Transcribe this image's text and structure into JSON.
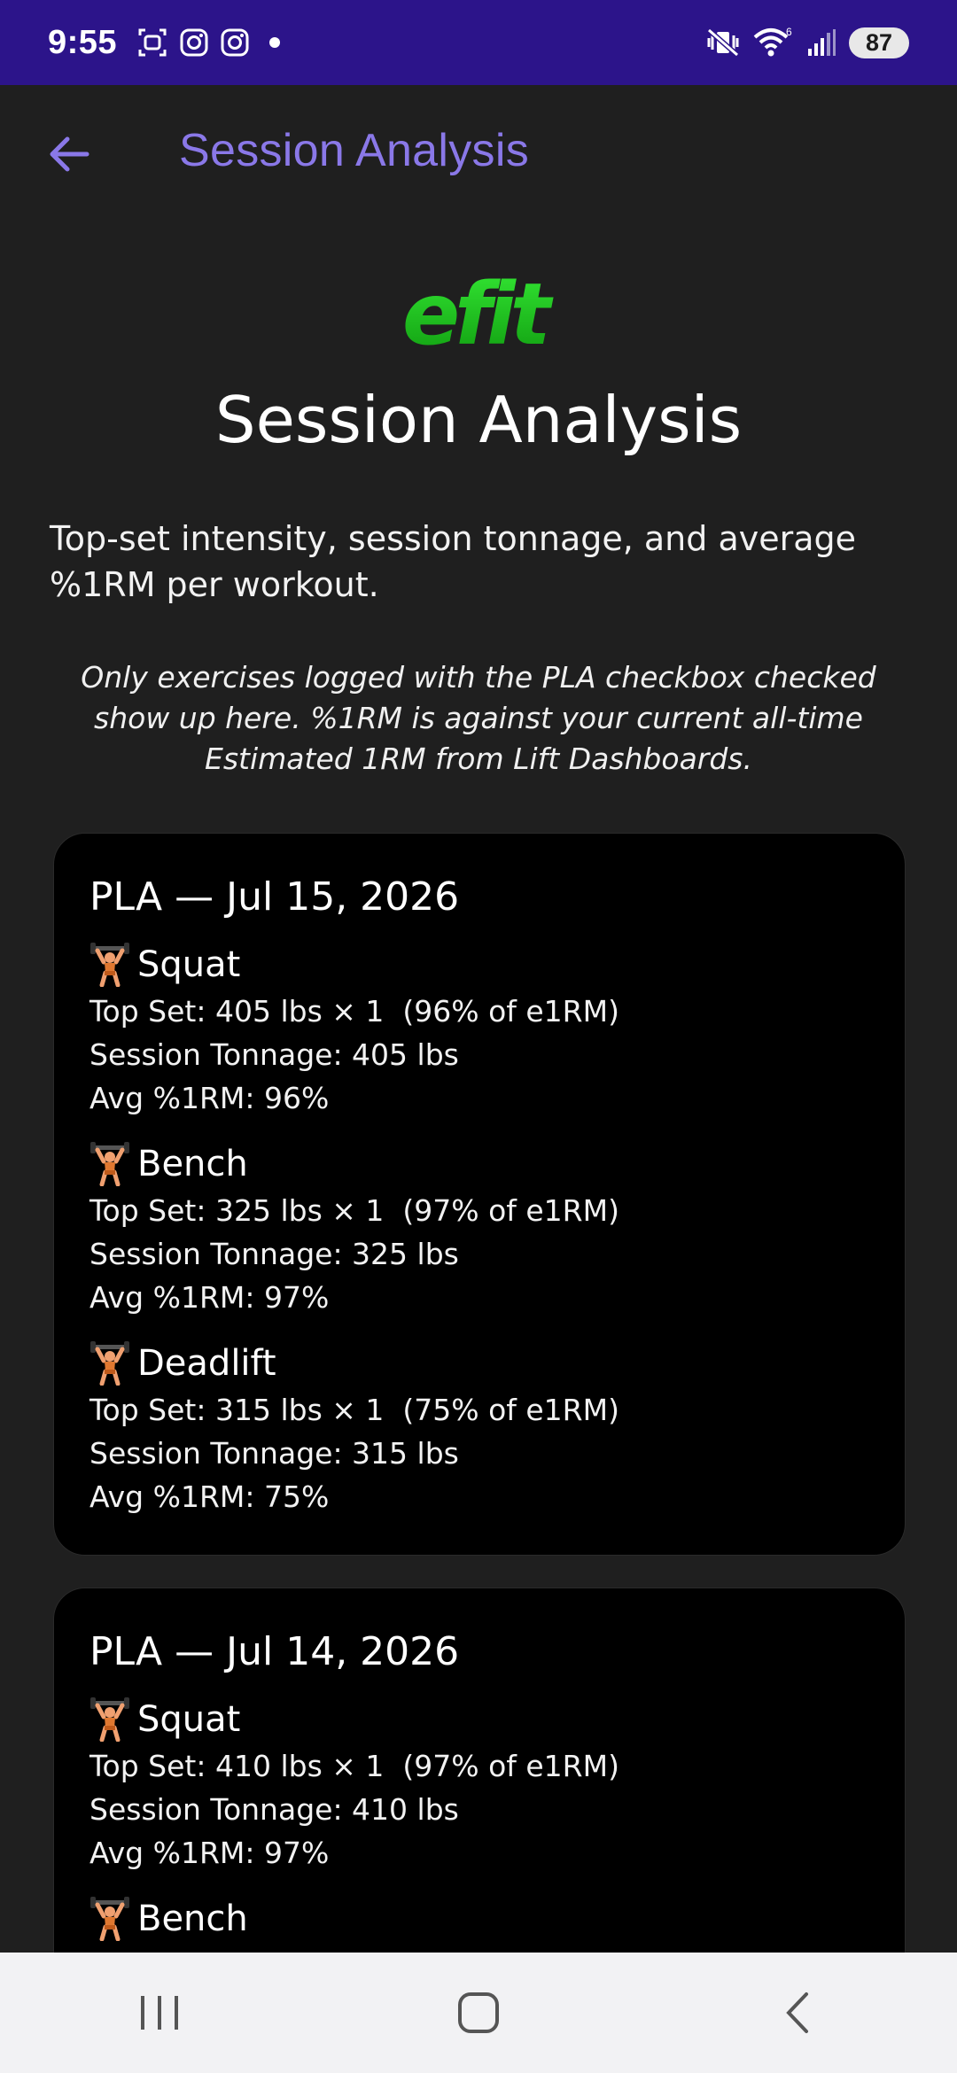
{
  "status_bar": {
    "time": "9:55",
    "battery": "87",
    "background": "#2c148a",
    "left_icons": [
      "screenshot-icon",
      "instagram-icon",
      "instagram-icon",
      "notification-dot-icon"
    ],
    "right_icons": [
      "mute-vibrate-icon",
      "wifi-icon",
      "signal-icon",
      "battery-icon"
    ],
    "wifi_badge": "6"
  },
  "app_bar": {
    "title": "Session Analysis",
    "back_icon": "arrow-left-icon",
    "accent_color": "#8a78e8"
  },
  "page": {
    "logo_text": "efit",
    "logo_color": "#1fcc1f",
    "title": "Session Analysis",
    "description": "Top-set intensity, session tonnage, and average %1RM per workout.",
    "note": "Only exercises logged with the PLA checkbox checked show up here. %1RM is against your current all-time Estimated 1RM from Lift Dashboards."
  },
  "sessions": [
    {
      "title": "PLA — Jul 15, 2026",
      "exercises": [
        {
          "name": "Squat",
          "top_set": "Top Set: 405 lbs × 1  (96% of e1RM)",
          "tonnage": "Session Tonnage: 405 lbs",
          "avg": "Avg %1RM: 96%"
        },
        {
          "name": "Bench",
          "top_set": "Top Set: 325 lbs × 1  (97% of e1RM)",
          "tonnage": "Session Tonnage: 325 lbs",
          "avg": "Avg %1RM: 97%"
        },
        {
          "name": "Deadlift",
          "top_set": "Top Set: 315 lbs × 1  (75% of e1RM)",
          "tonnage": "Session Tonnage: 315 lbs",
          "avg": "Avg %1RM: 75%"
        }
      ]
    },
    {
      "title": "PLA — Jul 14, 2026",
      "exercises": [
        {
          "name": "Squat",
          "top_set": "Top Set: 410 lbs × 1  (97% of e1RM)",
          "tonnage": "Session Tonnage: 410 lbs",
          "avg": "Avg %1RM: 97%"
        },
        {
          "name": "Bench",
          "top_set": "",
          "tonnage": "",
          "avg": ""
        }
      ]
    }
  ],
  "nav_bar": {
    "buttons": [
      "recents-icon",
      "home-icon",
      "back-icon"
    ]
  }
}
